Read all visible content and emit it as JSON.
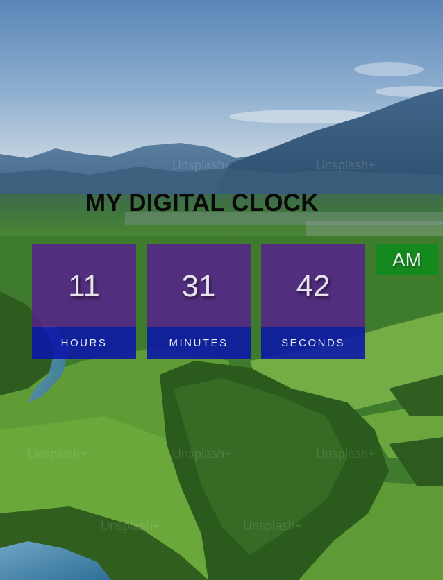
{
  "page": {
    "title": "MY DIGITAL CLOCK"
  },
  "clock": {
    "hours": {
      "value": "11",
      "label": "HOURS"
    },
    "minutes": {
      "value": "31",
      "label": "MINUTES"
    },
    "seconds": {
      "value": "42",
      "label": "SECONDS"
    },
    "period": "AM"
  },
  "background": {
    "watermark_text": "Unsplash+"
  },
  "colors": {
    "digit_box": "#581c94",
    "label_box": "#0a14aa",
    "period_box": "#148a1e",
    "title": "#0a0a0a"
  }
}
